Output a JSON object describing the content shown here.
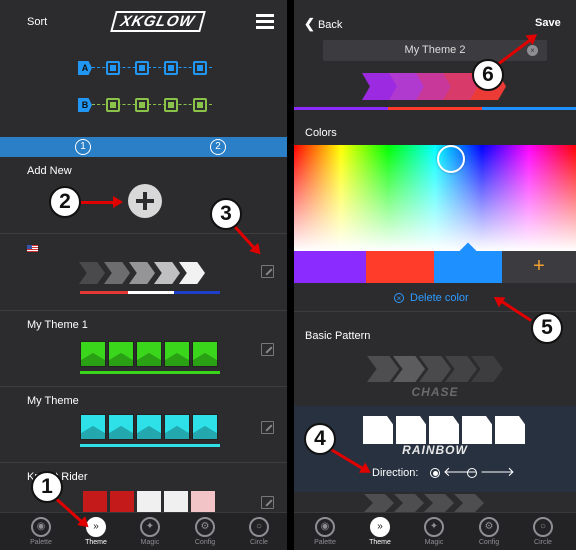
{
  "left": {
    "header": {
      "sort_label": "Sort",
      "logo_text": "XKGLOW",
      "menu_icon": "hamburger-icon"
    },
    "modules": {
      "a_label": "A",
      "b_label": "B",
      "a_color": "#2196f3",
      "b_color": "#8bc34a"
    },
    "zone_tabs": [
      {
        "label": "1"
      },
      {
        "label": "2"
      }
    ],
    "add_new": {
      "title": "Add New",
      "icon": "plus-icon"
    },
    "themes": [
      {
        "title": "",
        "flag": "us-flag-icon"
      },
      {
        "title": "My Theme 1"
      },
      {
        "title": "My Theme"
      },
      {
        "title": "Knight Rider"
      }
    ]
  },
  "right": {
    "header": {
      "back_label": "Back",
      "save_label": "Save"
    },
    "theme_name": "My Theme 2",
    "colors_label": "Colors",
    "swatches": [
      {
        "color": "#8b2bff"
      },
      {
        "color": "#ff3b2a"
      },
      {
        "color": "#1e90ff"
      }
    ],
    "add_color_icon": "+",
    "delete_color_label": "Delete color",
    "basic_pattern_label": "Basic Pattern",
    "patterns": [
      {
        "name": "CHASE"
      },
      {
        "name": "RAINBOW"
      }
    ],
    "direction_label": "Direction:"
  },
  "tabbar": [
    {
      "label": "Palette",
      "icon": "palette-icon"
    },
    {
      "label": "Theme",
      "icon": "theme-icon"
    },
    {
      "label": "Magic",
      "icon": "magic-wand-icon"
    },
    {
      "label": "Config",
      "icon": "gear-icon"
    },
    {
      "label": "Circle",
      "icon": "circle-icon"
    }
  ],
  "callouts": [
    "1",
    "2",
    "3",
    "4",
    "5",
    "6"
  ]
}
